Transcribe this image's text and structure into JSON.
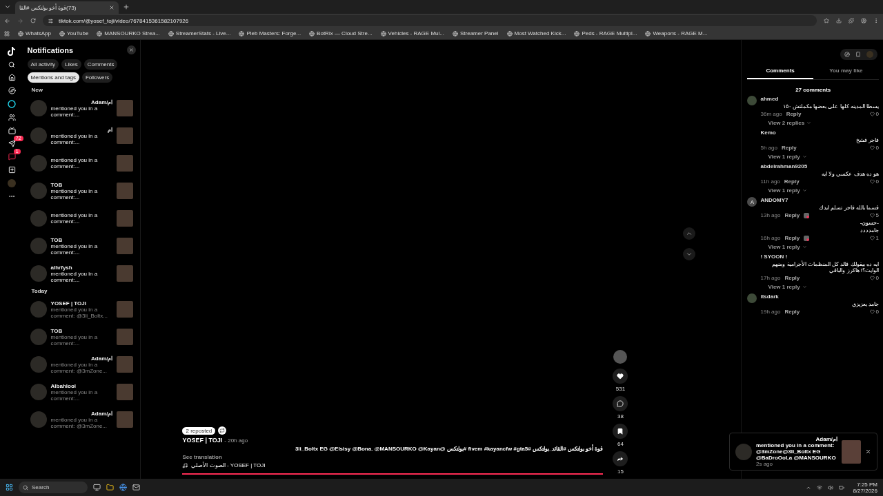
{
  "browser": {
    "tab": {
      "title": "(73)قوة أخو بولتكس #القا",
      "selected": true
    },
    "url": "tiktok.com/@yosef_toji/video/7678415361582107926",
    "bookmarks": [
      "WhatsApp",
      "YouTube",
      "MANSOURKO Strea...",
      "StreamerStats - Live...",
      "Pleb Masters: Forge...",
      "BotRix — Cloud Stre...",
      "Vehicles - RAGE Mul...",
      "Streamer Panel",
      "Most Watched Kick...",
      "Peds - RAGE Multipl...",
      "Weapons - RAGE M..."
    ]
  },
  "rail": {
    "badges": [
      {
        "kind": "activity",
        "count": "72"
      },
      {
        "kind": "messages",
        "count": "1"
      }
    ]
  },
  "notifications": {
    "title": "Notifications",
    "filters": [
      {
        "label": "All activity",
        "selected": false
      },
      {
        "label": "Likes",
        "selected": false
      },
      {
        "label": "Comments",
        "selected": false
      },
      {
        "label": "Mentions and tags",
        "selected": true
      },
      {
        "label": "Followers",
        "selected": false
      }
    ],
    "sections": [
      {
        "heading": "New",
        "items": [
          {
            "name": "ام/Adam",
            "text": "mentioned you in a comment:...",
            "read": false
          },
          {
            "name": "ام",
            "text": "mentioned you in a comment:...",
            "read": false
          },
          {
            "text": "mentioned you in a comment:...",
            "read": false
          },
          {
            "name": "TOB",
            "text": "mentioned you in a comment:...",
            "read": false
          },
          {
            "text": "mentioned you in a comment:...",
            "read": false
          },
          {
            "name": "TOB",
            "text": "mentioned you in a comment:...",
            "read": false
          },
          {
            "name": "alhrfysh",
            "text": "mentioned you in a comment:...",
            "read": false
          }
        ]
      },
      {
        "heading": "Today",
        "items": [
          {
            "name": "YOSEF | TOJI",
            "text": "mentioned you in a comment: @3li_Boltx...",
            "read": true
          },
          {
            "name": "TOB",
            "text": "mentioned you in a comment:...",
            "read": true
          },
          {
            "name": "ام/Adam",
            "text": "mentioned you in a comment: @3mZone...",
            "read": true
          },
          {
            "name": "Albahlool",
            "text": "mentioned you in a comment:...",
            "read": true
          },
          {
            "name": "ام/Adam",
            "text": "mentioned you in a comment: @3mZone...",
            "read": true
          }
        ]
      }
    ]
  },
  "video": {
    "reposts": "2 reposted",
    "author": "YOSEF | TOJI",
    "time": "- 20h ago",
    "description": "قوة أخو بولتكس #القائد_بولتكس #fivem #kayancfw #gta5 #بولتكس @3li_Boltx EG @Elsisy @Bona. @MANSOURKO @Kayan",
    "translate": "See translation",
    "sound": "الصوت الأصلي - YOSEF | TOJI",
    "progress": {
      "level": 1
    },
    "actions": [
      {
        "kind": "like",
        "count": "531"
      },
      {
        "kind": "comment",
        "count": "38"
      },
      {
        "kind": "save",
        "count": "64"
      },
      {
        "kind": "share",
        "count": "15"
      }
    ]
  },
  "comments": {
    "tabs": [
      {
        "label": "Comments",
        "selected": true
      },
      {
        "label": "You may like",
        "selected": false
      }
    ],
    "count": "27 comments",
    "items": [
      {
        "user": "ahmed",
        "avatar": {
          "kind": "photo"
        },
        "text": "يسطا المدينه كلها على بعضها مكملتش ١٥٠",
        "time": "36m ago",
        "reply": "Reply",
        "likes": "0",
        "creator_liked": false,
        "replies": "View 2 replies"
      },
      {
        "user": "Kemo",
        "text": "فاجر فشخ",
        "time": "5h ago",
        "reply": "Reply",
        "likes": "0",
        "creator_liked": false,
        "replies": "View 1 reply"
      },
      {
        "user": "abdelrahman9205",
        "text": "هو ده هدف عكسي ولا ايه",
        "time": "11h ago",
        "reply": "Reply",
        "likes": "0",
        "creator_liked": false,
        "replies": "View 1 reply"
      },
      {
        "user": "ANDOMY7",
        "avatar": {
          "kind": "letter",
          "letter": "A"
        },
        "text": "قسما بالله فاجر تسلم ايدك",
        "time": "13h ago",
        "reply": "Reply",
        "likes": "5",
        "creator_liked": true
      },
      {
        "user": "-حسون-",
        "text": "جامدددد",
        "time": "16h ago",
        "reply": "Reply",
        "likes": "1",
        "creator_liked": true,
        "replies": "View 1 reply"
      },
      {
        "user": "! SYOON !",
        "text": "ايه ده بيقولك قالد كل المنظمات الأجرامية ومنهم الوايت؟! هاكرز والباقي",
        "time": "17h ago",
        "reply": "Reply",
        "likes": "0",
        "creator_liked": false,
        "replies": "View 1 reply"
      },
      {
        "user": "itsdark",
        "avatar": {
          "kind": "photo"
        },
        "text": "جامد يعزيزي",
        "time": "19h ago",
        "reply": "Reply",
        "likes": "0",
        "creator_liked": false
      }
    ]
  },
  "toast": {
    "name": "ام/Adam",
    "text": "mentioned you in a comment: @3mZone@3li_Boltx EG @BaDroOoLa @MANSOURKO",
    "time": "2s ago"
  },
  "taskbar": {
    "search": "Search",
    "time": "7:25 PM",
    "date": "8/27/2026"
  }
}
